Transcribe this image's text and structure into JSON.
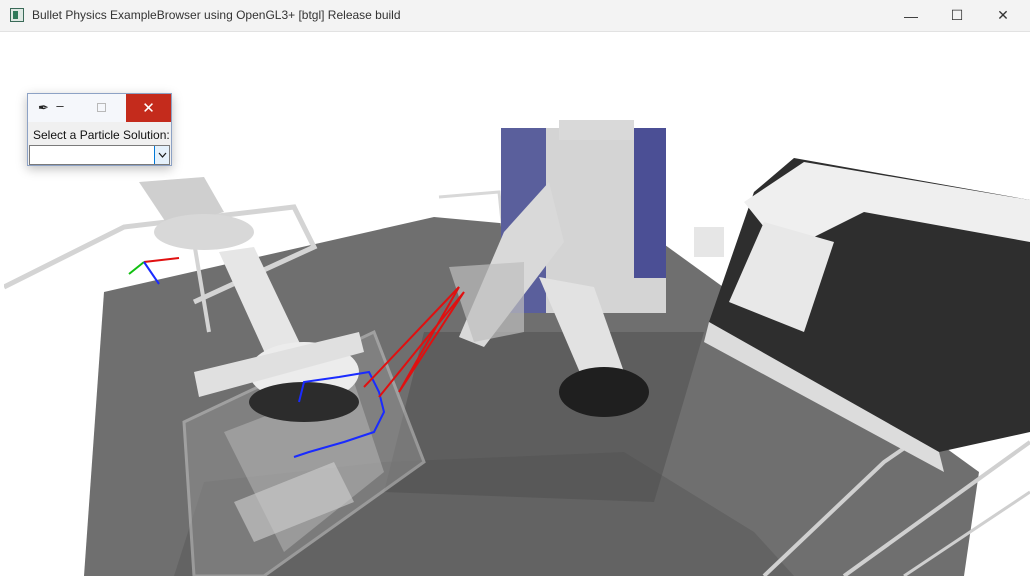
{
  "window": {
    "title": "Bullet Physics ExampleBrowser using OpenGL3+ [btgl] Release build",
    "icon": "app-window-icon",
    "controls": {
      "minimize": "—",
      "maximize": "☐",
      "close": "✕"
    }
  },
  "particle_dialog": {
    "title_icon": "feather-icon",
    "label": "Select a Particle Solution:",
    "selected_value": "",
    "close_color": "#c42b1c"
  },
  "scene": {
    "description_colors": {
      "floor": "#6e6e6e",
      "fence": "#cfcfcf",
      "machine": "#2d2d2d",
      "path_blue": "#1a2bff",
      "path_red": "#e01010"
    }
  }
}
